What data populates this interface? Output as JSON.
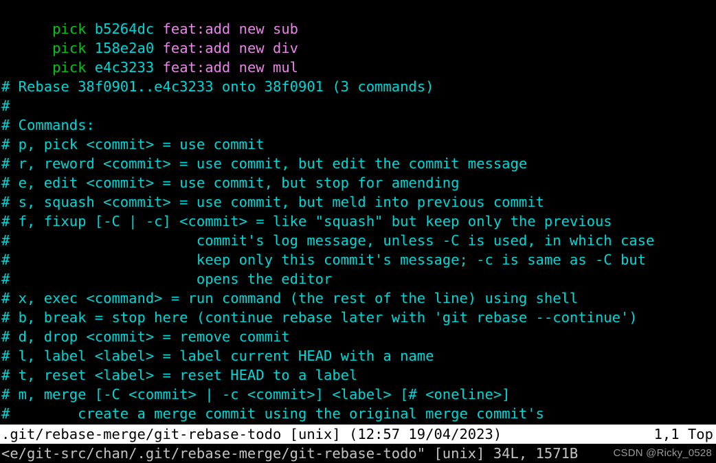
{
  "editor": {
    "name": "vim",
    "colors": {
      "background": "#000000",
      "command_keyword": "#00c612",
      "commit_hash": "#00d7d7",
      "commit_message": "#ea85ea",
      "comment": "#00d7d7",
      "status_bar_bg": "#ffffff",
      "status_bar_fg": "#000000",
      "command_line_fg": "#c4c4c4",
      "watermark": "#9a9a9a"
    }
  },
  "todo_entries": [
    {
      "command": "pick",
      "hash": "b5264dc",
      "message": "feat:add new sub"
    },
    {
      "command": "pick",
      "hash": "158e2a0",
      "message": "feat:add new div"
    },
    {
      "command": "pick",
      "hash": "e4c3233",
      "message": "feat:add new mul"
    }
  ],
  "comment_lines": [
    "",
    "# Rebase 38f0901..e4c3233 onto 38f0901 (3 commands)",
    "#",
    "# Commands:",
    "# p, pick <commit> = use commit",
    "# r, reword <commit> = use commit, but edit the commit message",
    "# e, edit <commit> = use commit, but stop for amending",
    "# s, squash <commit> = use commit, but meld into previous commit",
    "# f, fixup [-C | -c] <commit> = like \"squash\" but keep only the previous",
    "#                      commit's log message, unless -C is used, in which case",
    "#                      keep only this commit's message; -c is same as -C but",
    "#                      opens the editor",
    "# x, exec <command> = run command (the rest of the line) using shell",
    "# b, break = stop here (continue rebase later with 'git rebase --continue')",
    "# d, drop <commit> = remove commit",
    "# l, label <label> = label current HEAD with a name",
    "# t, reset <label> = reset HEAD to a label",
    "# m, merge [-C <commit> | -c <commit>] <label> [# <oneline>]",
    "#        create a merge commit using the original merge commit's"
  ],
  "status_bar": {
    "file_path": ".git/rebase-merge/git-rebase-todo",
    "file_format": "[unix]",
    "timestamp": "(12:57 19/04/2023)",
    "left_text": ".git/rebase-merge/git-rebase-todo [unix] (12:57 19/04/2023)",
    "cursor_position": "1,1",
    "scroll_position": "Top",
    "right_text": "1,1 Top"
  },
  "command_line": {
    "text": "<e/git-src/chan/.git/rebase-merge/git-rebase-todo\" [unix] 34L, 1571B",
    "truncated_path": "<e/git-src/chan/.git/rebase-merge/git-rebase-todo\"",
    "file_format": "[unix]",
    "line_count": "34L",
    "byte_count": "1571B"
  },
  "watermark": {
    "text": "CSDN @Ricky_0528"
  }
}
